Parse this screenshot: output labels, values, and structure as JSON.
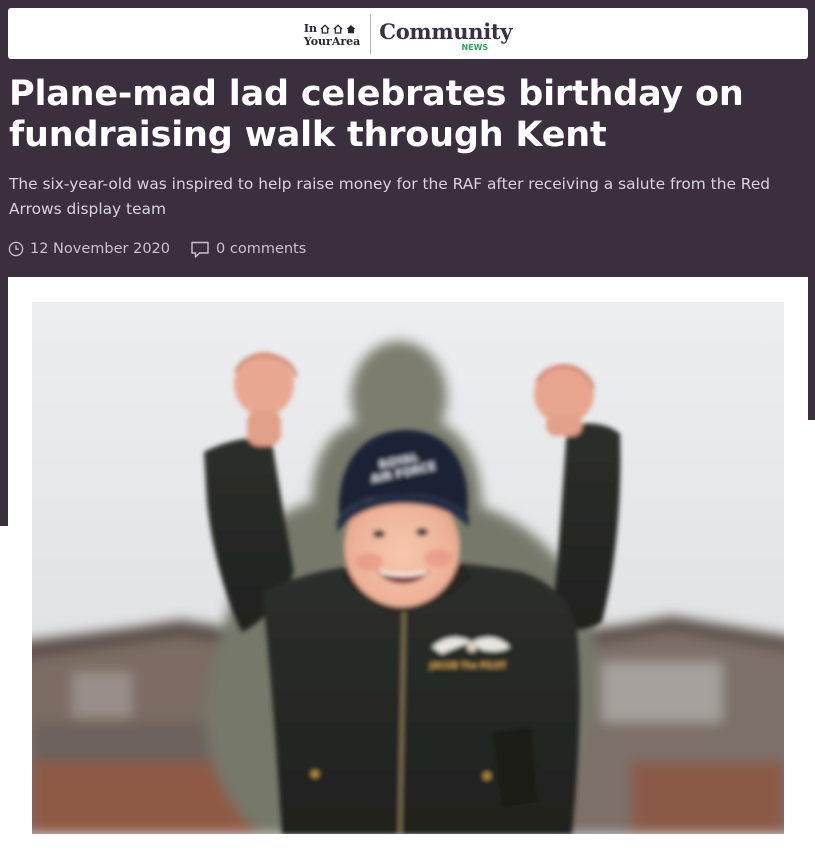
{
  "brand": {
    "site_logo_line1": "In",
    "site_logo_line2": "YourArea",
    "section_name": "Community",
    "section_tag": "NEWS"
  },
  "article": {
    "headline": "Plane-mad lad celebrates birthday on fundraising walk through Kent",
    "standfirst": "The six-year-old was inspired to help raise money for the RAF after receiving a salute from the Red Arrows display team",
    "date": "12 November 2020",
    "comments": "0 comments",
    "photo": {
      "hat_text": "ROYAL AIR FORCE",
      "badge_text": "JACOB The PILOT"
    }
  },
  "colors": {
    "header_bg": "#3a2f3d",
    "headline_text": "#ffffff",
    "community_text": "#3a2f45",
    "news_green": "#2aa65c"
  },
  "icons": {
    "house_outline": "house-outline-icon",
    "house_filled": "house-filled-icon",
    "clock": "clock-icon",
    "comment": "comment-icon"
  }
}
